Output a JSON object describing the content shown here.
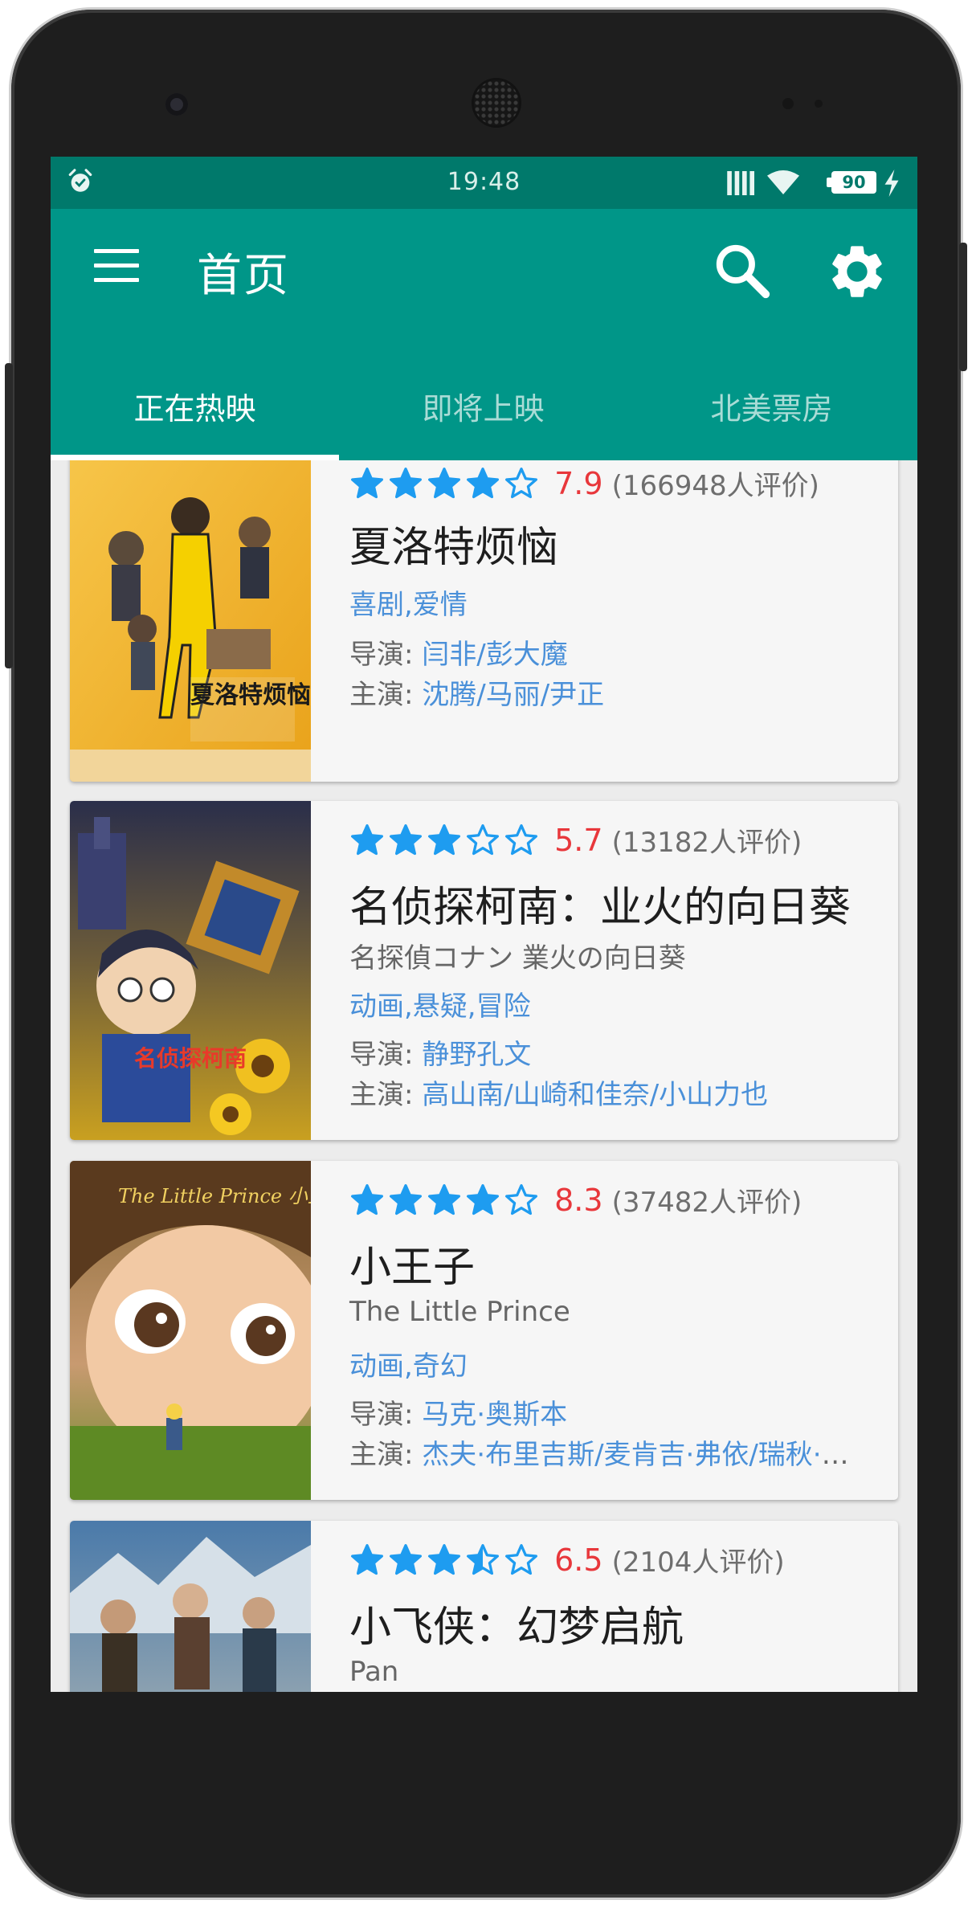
{
  "status_bar": {
    "time": "19:48",
    "battery": "90"
  },
  "app_bar": {
    "title": "首页",
    "menu_icon": "menu-icon",
    "search_icon": "search-icon",
    "settings_icon": "gear-icon"
  },
  "tabs": [
    {
      "label": "正在热映",
      "active": true
    },
    {
      "label": "即将上映",
      "active": false
    },
    {
      "label": "北美票房",
      "active": false
    }
  ],
  "labels": {
    "director": "导演: ",
    "cast": "主演: "
  },
  "colors": {
    "primary": "#009688",
    "primary_dark": "#00796b",
    "star": "#1e9cf0",
    "score": "#e8373b",
    "link": "#4a90d9"
  },
  "movies": [
    {
      "poster_text": "夏洛特烦恼",
      "stars": 4,
      "score": "7.9",
      "votes": "(166948人评价)",
      "title": "夏洛特烦恼",
      "original_title": "",
      "genres": "喜剧,爱情",
      "director": "闫非/彭大魔",
      "cast": "沈腾/马丽/尹正"
    },
    {
      "poster_text": "名侦探柯南",
      "stars": 3,
      "score": "5.7",
      "votes": "(13182人评价)",
      "title": "名侦探柯南：业火的向日葵",
      "original_title": "名探偵コナン 業火の向日葵",
      "genres": "动画,悬疑,冒险",
      "director": "静野孔文",
      "cast": "高山南/山崎和佳奈/小山力也"
    },
    {
      "poster_text": "The Little Prince 小王子",
      "stars": 4,
      "score": "8.3",
      "votes": "(37482人评价)",
      "title": "小王子",
      "original_title": "The Little Prince",
      "genres": "动画,奇幻",
      "director": "马克·奥斯本",
      "cast": "杰夫·布里吉斯/麦肯吉·弗依/瑞秋·麦克亚当斯"
    },
    {
      "poster_text": "",
      "stars": 3.5,
      "score": "6.5",
      "votes": "(2104人评价)",
      "title": "小飞侠：幻梦启航",
      "original_title": "Pan",
      "genres": "",
      "director": "",
      "cast": ""
    }
  ]
}
